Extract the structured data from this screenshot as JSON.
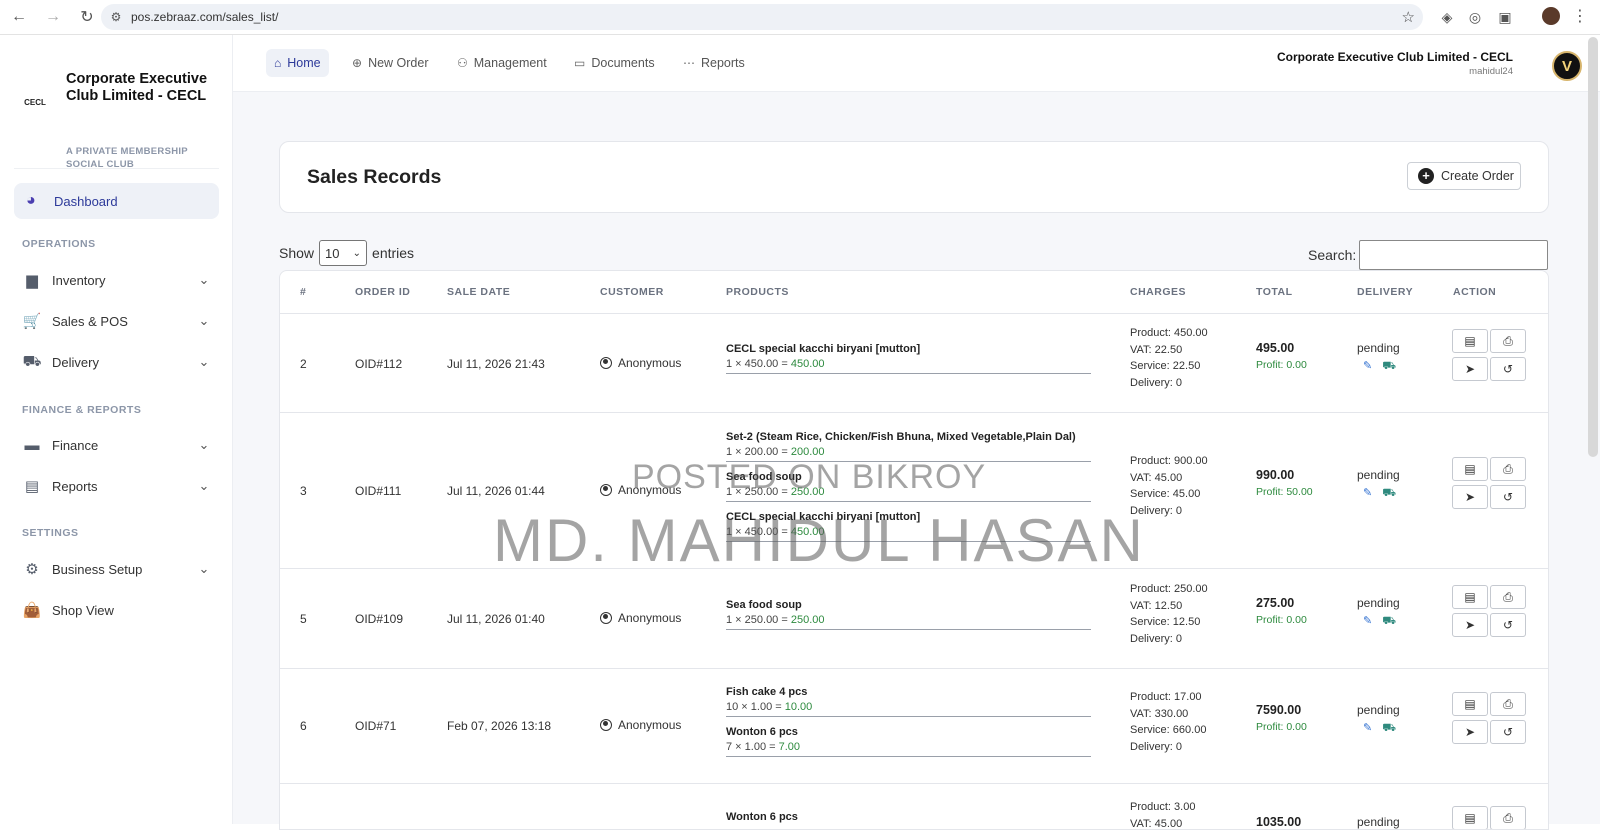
{
  "browser": {
    "url": "pos.zebraaz.com/sales_list/",
    "back": "←",
    "forward": "→",
    "reload": "↻",
    "tune": "⚙",
    "star": "☆",
    "menu": "⋮"
  },
  "sidebar": {
    "brand_name": "Corporate Executive Club Limited - CECL",
    "brand_tag": "A PRIVATE MEMBERSHIP SOCIAL CLUB",
    "logo_text": "CECL",
    "dashboard": "Dashboard",
    "sections": {
      "operations": "OPERATIONS",
      "finance": "FINANCE & REPORTS",
      "settings": "SETTINGS"
    },
    "items": {
      "inventory": "Inventory",
      "sales": "Sales & POS",
      "delivery": "Delivery",
      "finance": "Finance",
      "reports": "Reports",
      "business": "Business Setup",
      "shop": "Shop View"
    }
  },
  "topnav": {
    "tabs": [
      "Home",
      "New Order",
      "Management",
      "Documents",
      "Reports"
    ],
    "org_name": "Corporate Executive Club Limited - CECL",
    "username": "mahidul24",
    "avatar_letter": "V"
  },
  "page": {
    "title": "Sales Records",
    "create_label": "Create Order",
    "show_label": "Show",
    "entries_value": "10",
    "entries_label": "entries",
    "search_label": "Search:"
  },
  "table": {
    "headers": [
      "#",
      "ORDER ID",
      "SALE DATE",
      "CUSTOMER",
      "PRODUCTS",
      "CHARGES",
      "TOTAL",
      "DELIVERY",
      "ACTION"
    ],
    "rows": [
      {
        "num": "2",
        "order_id": "OID#112",
        "date": "Jul 11, 2026 21:43",
        "customer": "Anonymous",
        "products": [
          {
            "name": "CECL special kacchi biryani [mutton]",
            "qty": "1 × 450.00 =",
            "amount": "450.00"
          }
        ],
        "charges": {
          "product": "Product: 450.00",
          "vat": "VAT: 22.50",
          "service": "Service: 22.50",
          "delivery": "Delivery: 0"
        },
        "total": "495.00",
        "profit": "Profit: 0.00",
        "status": "pending"
      },
      {
        "num": "3",
        "order_id": "OID#111",
        "date": "Jul 11, 2026 01:44",
        "customer": "Anonymous",
        "products": [
          {
            "name": "Set-2 (Steam Rice, Chicken/Fish Bhuna, Mixed Vegetable,Plain Dal)",
            "qty": "1 × 200.00 =",
            "amount": "200.00"
          },
          {
            "name": "Sea food soup",
            "qty": "1 × 250.00 =",
            "amount": "250.00"
          },
          {
            "name": "CECL special kacchi biryani [mutton]",
            "qty": "1 × 450.00 =",
            "amount": "450.00"
          }
        ],
        "charges": {
          "product": "Product: 900.00",
          "vat": "VAT: 45.00",
          "service": "Service: 45.00",
          "delivery": "Delivery: 0"
        },
        "total": "990.00",
        "profit": "Profit: 50.00",
        "status": "pending"
      },
      {
        "num": "5",
        "order_id": "OID#109",
        "date": "Jul 11, 2026 01:40",
        "customer": "Anonymous",
        "products": [
          {
            "name": "Sea food soup",
            "qty": "1 × 250.00 =",
            "amount": "250.00"
          }
        ],
        "charges": {
          "product": "Product: 250.00",
          "vat": "VAT: 12.50",
          "service": "Service: 12.50",
          "delivery": "Delivery: 0"
        },
        "total": "275.00",
        "profit": "Profit: 0.00",
        "status": "pending"
      },
      {
        "num": "6",
        "order_id": "OID#71",
        "date": "Feb 07, 2026 13:18",
        "customer": "Anonymous",
        "products": [
          {
            "name": "Fish cake 4 pcs",
            "qty": "10 × 1.00 =",
            "amount": "10.00"
          },
          {
            "name": "Wonton 6 pcs",
            "qty": "7 × 1.00 =",
            "amount": "7.00"
          }
        ],
        "charges": {
          "product": "Product: 17.00",
          "vat": "VAT: 330.00",
          "service": "Service: 660.00",
          "delivery": "Delivery: 0"
        },
        "total": "7590.00",
        "profit": "Profit: 0.00",
        "status": "pending"
      },
      {
        "products": [
          {
            "name": "Wonton 6 pcs"
          }
        ],
        "charges": {
          "product": "Product: 3.00",
          "vat": "VAT: 45.00"
        },
        "total": "1035.00",
        "status": "pending"
      }
    ]
  },
  "watermark": {
    "line1": "POSTED ON BIKROY",
    "line2": "MD. MAHIDUL HASAN"
  }
}
